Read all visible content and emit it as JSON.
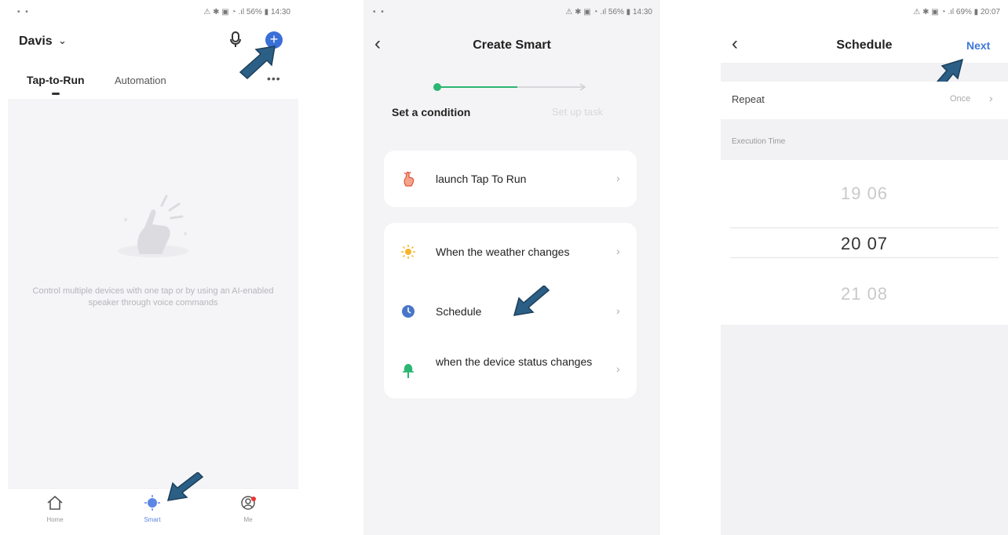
{
  "screen1": {
    "status_left": "• •",
    "status_right": "⚠ ✱ ▣ ◔ .ıl 56% ▮ 14:30",
    "home_name": "Davis",
    "tabs": [
      "Tap-to-Run",
      "Automation"
    ],
    "more": "•••",
    "empty_description": "Control multiple devices with one tap or by using an AI-enabled speaker through voice commands",
    "nav": [
      "Home",
      "Smart",
      "Me"
    ]
  },
  "screen2": {
    "status_left": "• •",
    "status_right": "⚠ ✱ ▣ ◔ .ıl 56% ▮ 14:30",
    "title": "Create Smart",
    "steps": [
      "Set a condition",
      "Set up task"
    ],
    "card1": [
      {
        "label": "launch Tap To Run",
        "icon": "tap-hand-icon"
      }
    ],
    "card2": [
      {
        "label": "When the weather changes",
        "icon": "sun-icon"
      },
      {
        "label": "Schedule",
        "icon": "clock-icon"
      },
      {
        "label": "when the device status changes",
        "icon": "device-icon"
      }
    ]
  },
  "screen3": {
    "status_right": "⚠ ✱ ▣ ◔ .ıl 69% ▮ 20:07",
    "title": "Schedule",
    "next": "Next",
    "repeat_label": "Repeat",
    "repeat_value": "Once",
    "exec_label": "Execution Time",
    "picker": [
      {
        "hour": "19",
        "minute": "06"
      },
      {
        "hour": "20",
        "minute": "07"
      },
      {
        "hour": "21",
        "minute": "08"
      }
    ]
  },
  "colors": {
    "accent": "#3f78d8",
    "arrow": "#2b5f86",
    "progress": "#2bb673"
  }
}
